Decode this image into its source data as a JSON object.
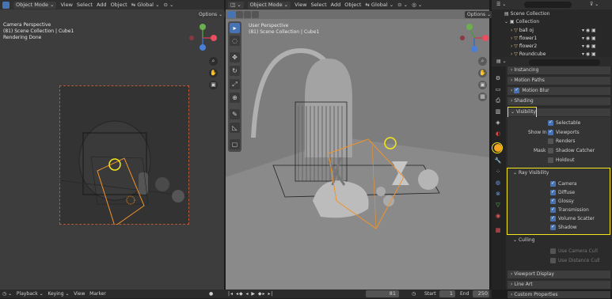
{
  "left_view": {
    "header": {
      "mode": "Object Mode",
      "menu": [
        "View",
        "Select",
        "Add",
        "Object"
      ],
      "orientation": "Global"
    },
    "options": "Options",
    "info": [
      "Camera Perspective",
      "(81) Scene Collection | Cube1",
      "Rendering Done"
    ]
  },
  "mid_view": {
    "header": {
      "mode": "Object Mode",
      "menu": [
        "View",
        "Select",
        "Add",
        "Object"
      ],
      "orientation": "Global"
    },
    "options": "Options",
    "info": [
      "User Perspective",
      "(81) Scene Collection | Cube1"
    ]
  },
  "outliner": {
    "root": "Scene Collection",
    "collection": "Collection",
    "items": [
      "ball oj",
      "flower1",
      "flower2",
      "Roundcube"
    ]
  },
  "properties": {
    "sections_top": [
      "Instancing",
      "Motion Paths",
      "Motion Blur",
      "Shading"
    ],
    "visibility": {
      "title": "Visibility",
      "selectable": "Selectable",
      "show_in": "Show In",
      "viewports": "Viewports",
      "renders": "Renders",
      "mask": "Mask",
      "shadow_catcher": "Shadow Catcher",
      "holdout": "Holdout"
    },
    "ray_visibility": {
      "title": "Ray Visibility",
      "items": [
        "Camera",
        "Diffuse",
        "Glossy",
        "Transmission",
        "Volume Scatter",
        "Shadow"
      ]
    },
    "culling": {
      "title": "Culling",
      "items": [
        "Use Camera Cull",
        "Use Distance Cull"
      ]
    },
    "sections_bottom": [
      "Viewport Display",
      "Line Art",
      "Custom Properties"
    ]
  },
  "timeline": {
    "menu": [
      "Playback",
      "Keying",
      "View",
      "Marker"
    ],
    "frame": "81",
    "start_label": "Start",
    "start": "1",
    "end_label": "End",
    "end": "250"
  },
  "colors": {
    "highlight": "#f5e71a",
    "accent": "#4772b3",
    "camera": "#f0932b"
  }
}
